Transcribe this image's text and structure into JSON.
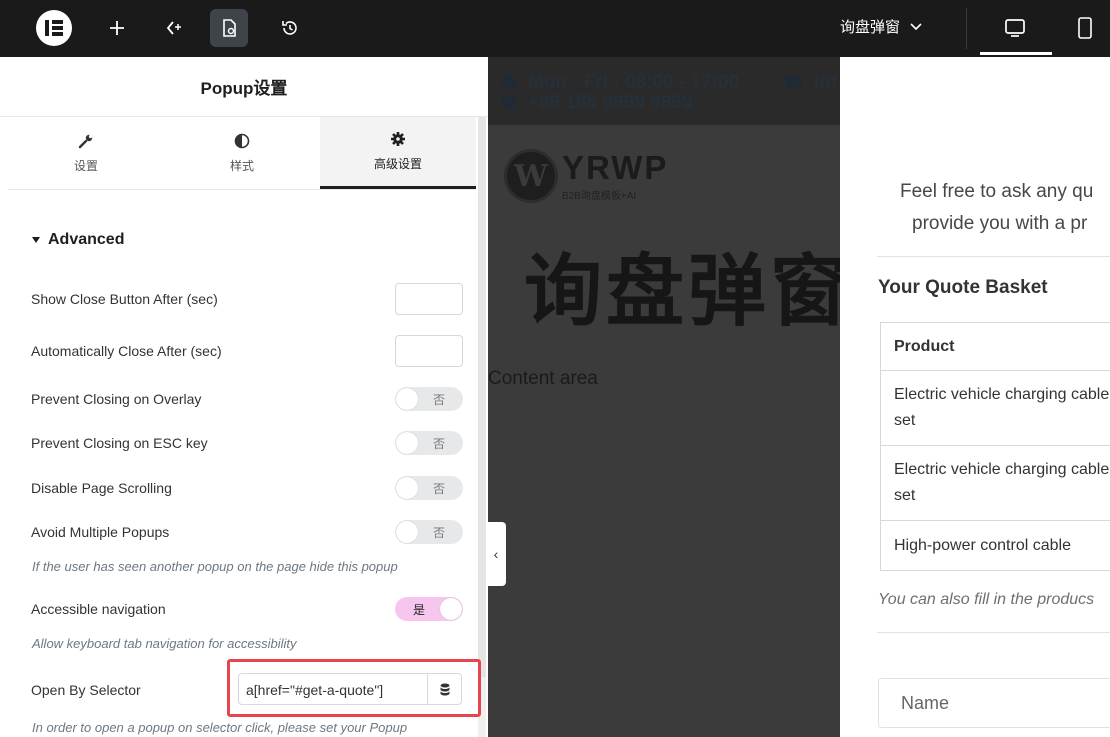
{
  "topbar": {
    "logo_text": "IE",
    "doc_title": "询盘弹窗"
  },
  "panel": {
    "title": "Popup设置",
    "tabs": [
      {
        "label": "设置",
        "icon": "wrench-icon"
      },
      {
        "label": "样式",
        "icon": "half-circle-icon"
      },
      {
        "label": "高级设置",
        "icon": "gear-icon",
        "active": true
      }
    ],
    "section_title": "Advanced",
    "fields": {
      "close_button_after": {
        "label": "Show Close Button After (sec)",
        "value": ""
      },
      "auto_close_after": {
        "label": "Automatically Close After (sec)",
        "value": ""
      },
      "prevent_overlay": {
        "label": "Prevent Closing on Overlay",
        "state": "否"
      },
      "prevent_esc": {
        "label": "Prevent Closing on ESC key",
        "state": "否"
      },
      "disable_scrolling": {
        "label": "Disable Page Scrolling",
        "state": "否"
      },
      "avoid_multiple": {
        "label": "Avoid Multiple Popups",
        "state": "否",
        "hint": "If the user has seen another popup on the page hide this popup"
      },
      "accessible_nav": {
        "label": "Accessible navigation",
        "state": "是",
        "hint": "Allow keyboard tab navigation for accessibility"
      },
      "open_by_selector": {
        "label": "Open By Selector",
        "value": "a[href=\"#get-a-quote\"]",
        "hint": "In order to open a popup on selector click, please set your Popup"
      }
    },
    "colors": {
      "accent_on": "#f7c6ee",
      "highlight": "#e6454f"
    }
  },
  "preview": {
    "info_line1": "Mon - Fri : 08:00 - 17:00",
    "info_line1_cont": "inf",
    "info_line2": "+86 185 9999 9999",
    "site_name": "YRWP",
    "site_tagline": "B2B询盘模板+AI",
    "heading": "询盘弹窗",
    "content_area": "Content area"
  },
  "popup": {
    "intro_line1": "Feel free to ask any qu",
    "intro_line2": "provide you with a pr",
    "basket_title": "Your Quote Basket",
    "table_header": "Product",
    "products": [
      "Electric vehicle charging cable set",
      "Electric vehicle charging cable set",
      "High-power control cable"
    ],
    "note": "You can also fill in the producs",
    "name_placeholder": "Name"
  }
}
